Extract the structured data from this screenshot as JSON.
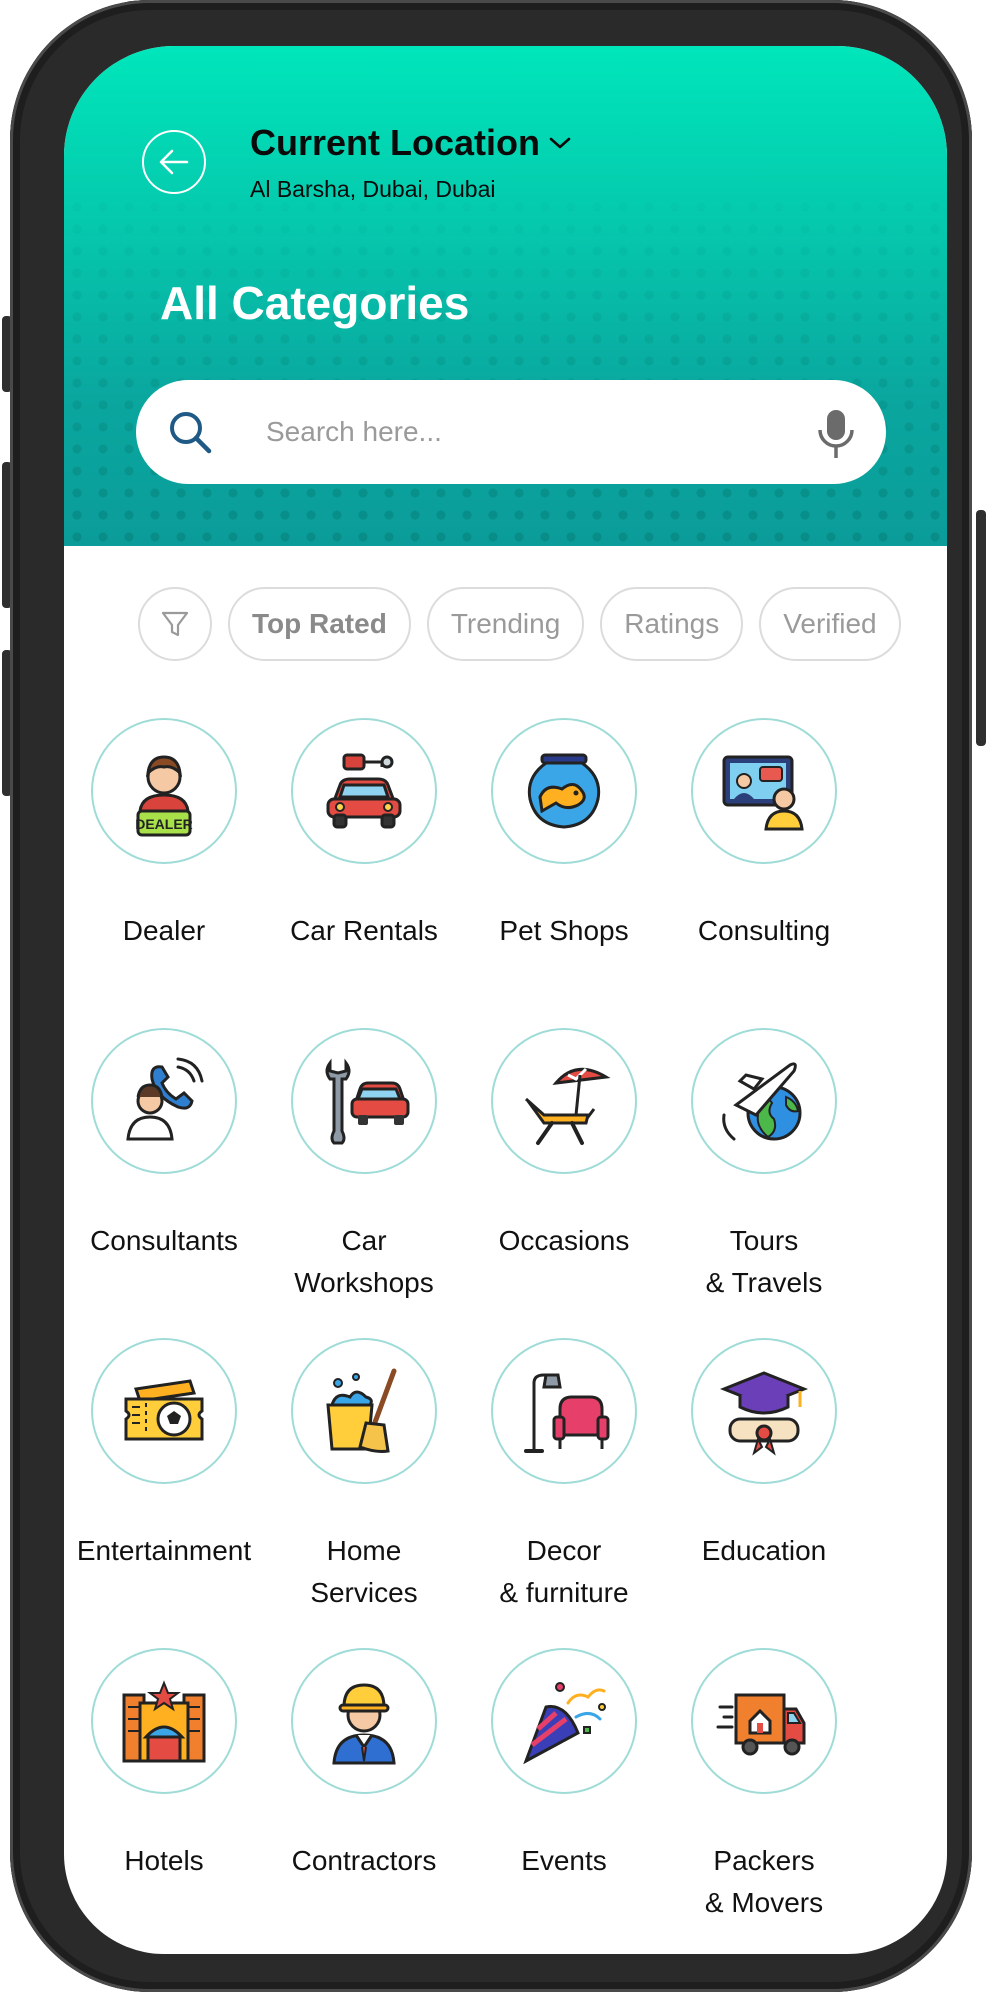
{
  "header": {
    "location_title": "Current Location",
    "location_sub": "Al Barsha, Dubai, Dubai",
    "page_title": "All Categories"
  },
  "search": {
    "placeholder": "Search here..."
  },
  "filters": [
    "Top Rated",
    "Trending",
    "Ratings",
    "Verified"
  ],
  "categories": [
    {
      "label": "Dealer",
      "icon": "dealer-icon"
    },
    {
      "label": "Car Rentals",
      "icon": "car-rental-icon"
    },
    {
      "label": "Pet Shops",
      "icon": "fishbowl-icon"
    },
    {
      "label": "Consulting",
      "icon": "consulting-icon"
    },
    {
      "label": "Consultants",
      "icon": "consultant-phone-icon"
    },
    {
      "label": "Car\nWorkshops",
      "icon": "car-workshop-icon"
    },
    {
      "label": "Occasions",
      "icon": "beach-chair-icon"
    },
    {
      "label": "Tours\n& Travels",
      "icon": "globe-plane-icon"
    },
    {
      "label": "Entertainment",
      "icon": "ticket-icon"
    },
    {
      "label": "Home\nServices",
      "icon": "cleaning-bucket-icon"
    },
    {
      "label": "Decor\n& furniture",
      "icon": "armchair-lamp-icon"
    },
    {
      "label": "Education",
      "icon": "graduation-cap-icon"
    },
    {
      "label": "Hotels",
      "icon": "hotel-icon"
    },
    {
      "label": "Contractors",
      "icon": "construction-worker-icon"
    },
    {
      "label": "Events",
      "icon": "party-popper-icon"
    },
    {
      "label": "Packers\n& Movers",
      "icon": "moving-truck-icon"
    }
  ],
  "colors": {
    "header_top": "#00e6bb",
    "header_bottom": "#0b9c99",
    "circle_border": "#9fdcd7",
    "chip_border": "#dcdcdc",
    "search_icon": "#1f5a87"
  }
}
